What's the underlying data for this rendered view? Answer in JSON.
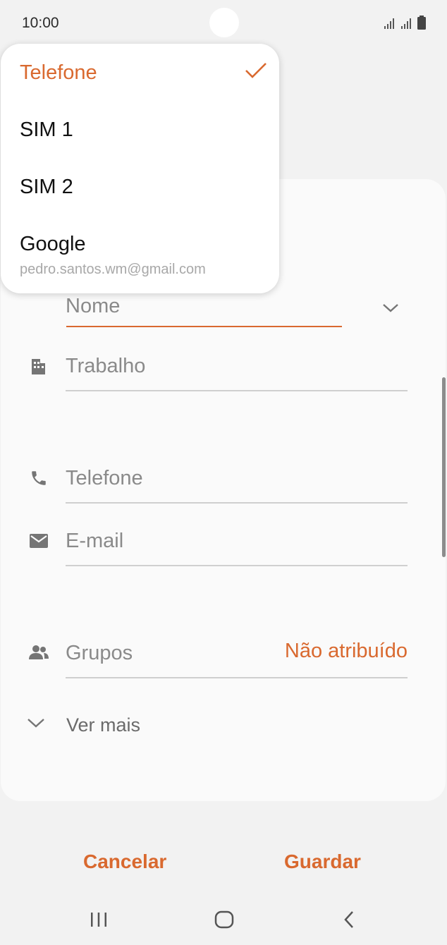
{
  "status": {
    "time": "10:00"
  },
  "form": {
    "name_placeholder": "Nome",
    "work_placeholder": "Trabalho",
    "phone_placeholder": "Telefone",
    "email_placeholder": "E-mail",
    "groups_label": "Grupos",
    "groups_value": "Não atribuído",
    "see_more": "Ver mais"
  },
  "actions": {
    "cancel": "Cancelar",
    "save": "Guardar"
  },
  "dropdown": {
    "items": [
      {
        "label": "Telefone",
        "selected": true
      },
      {
        "label": "SIM 1"
      },
      {
        "label": "SIM 2"
      },
      {
        "label": "Google",
        "sub": "pedro.santos.wm@gmail.com"
      }
    ]
  },
  "colors": {
    "accent": "#d9692f",
    "icon": "#757575"
  }
}
